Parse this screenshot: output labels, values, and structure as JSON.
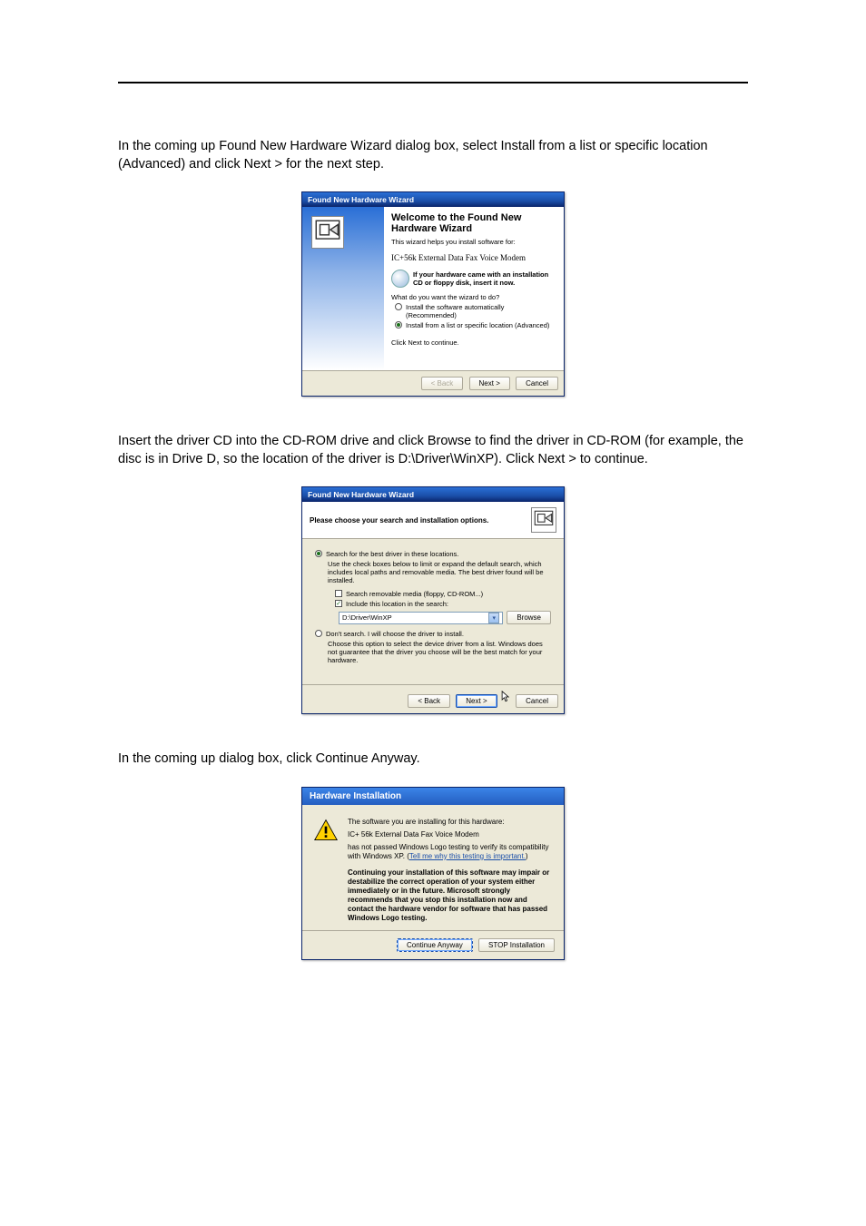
{
  "intro": "In the coming up Found New Hardware Wizard dialog box, select Install from a list or specific location (Advanced) and click Next > for the next step.",
  "mid1": "Insert the driver CD into the CD-ROM drive and click Browse to find the driver in CD-ROM (for example, the disc is in Drive D, so the location of the driver is D:\\Driver\\WinXP). Click Next > to continue.",
  "mid2": "In the coming up dialog box, click Continue Anyway.",
  "dlg1": {
    "title": "Found New Hardware Wizard",
    "heading": "Welcome to the Found New Hardware Wizard",
    "helps": "This wizard helps you install software for:",
    "device": "IC+56k External Data Fax Voice Modem",
    "cdtip": "If your hardware came with an installation CD or floppy disk, insert it now.",
    "question": "What do you want the wizard to do?",
    "opt1": "Install the software automatically (Recommended)",
    "opt2": "Install from a list or specific location (Advanced)",
    "click_next": "Click Next to continue.",
    "back": "< Back",
    "next": "Next >",
    "cancel": "Cancel"
  },
  "dlg2": {
    "title": "Found New Hardware Wizard",
    "heading": "Please choose your search and installation options.",
    "opt_search": "Search for the best driver in these locations.",
    "search_tip": "Use the check boxes below to limit or expand the default search, which includes local paths and removable media. The best driver found will be installed.",
    "chk_removable": "Search removable media (floppy, CD-ROM...)",
    "chk_include": "Include this location in the search:",
    "path": "D:\\Driver\\WinXP",
    "browse": "Browse",
    "opt_dont": "Don't search. I will choose the driver to install.",
    "dont_tip": "Choose this option to select the device driver from a list. Windows does not guarantee that the driver you choose will be the best match for your hardware.",
    "back": "< Back",
    "next": "Next >",
    "cancel": "Cancel"
  },
  "dlg3": {
    "title": "Hardware Installation",
    "line1": "The software you are installing for this hardware:",
    "device": "IC+ 56k External Data Fax Voice Modem",
    "line2a": "has not passed Windows Logo testing to verify its compatibility with Windows XP. (",
    "link": "Tell me why this testing is important.",
    "line2b": ")",
    "bold": "Continuing your installation of this software may impair or destabilize the correct operation of your system either immediately or in the future. Microsoft strongly recommends that you stop this installation now and contact the hardware vendor for software that has passed Windows Logo testing.",
    "continue": "Continue Anyway",
    "stop": "STOP Installation"
  }
}
